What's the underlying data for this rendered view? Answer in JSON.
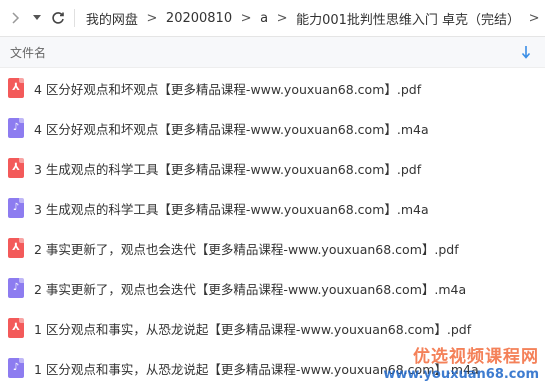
{
  "toolbar": {
    "breadcrumb": [
      "我的网盘",
      "20200810",
      "a",
      "能力001批判性思维入门 卓克（完结）"
    ],
    "separator": ">"
  },
  "header": {
    "column_title": "文件名"
  },
  "files": [
    {
      "name": "4 区分好观点和坏观点【更多精品课程-www.youxuan68.com】.pdf",
      "type": "pdf"
    },
    {
      "name": "4 区分好观点和坏观点【更多精品课程-www.youxuan68.com】.m4a",
      "type": "m4a"
    },
    {
      "name": "3 生成观点的科学工具【更多精品课程-www.youxuan68.com】.pdf",
      "type": "pdf"
    },
    {
      "name": "3 生成观点的科学工具【更多精品课程-www.youxuan68.com】.m4a",
      "type": "m4a"
    },
    {
      "name": "2 事实更新了，观点也会迭代【更多精品课程-www.youxuan68.com】.pdf",
      "type": "pdf"
    },
    {
      "name": "2 事实更新了，观点也会迭代【更多精品课程-www.youxuan68.com】.m4a",
      "type": "m4a"
    },
    {
      "name": "1 区分观点和事实，从恐龙说起【更多精品课程-www.youxuan68.com】.pdf",
      "type": "pdf"
    },
    {
      "name": "1 区分观点和事实，从恐龙说起【更多精品课程-www.youxuan68.com】.m4a",
      "type": "m4a"
    }
  ],
  "watermark": {
    "line1": "优选视频课程网",
    "line2": "www.youxuan68.com"
  },
  "colors": {
    "pdf_icon": "#f35a5a",
    "audio_icon": "#8d7cf0",
    "sort_arrow": "#3a8ee6"
  }
}
